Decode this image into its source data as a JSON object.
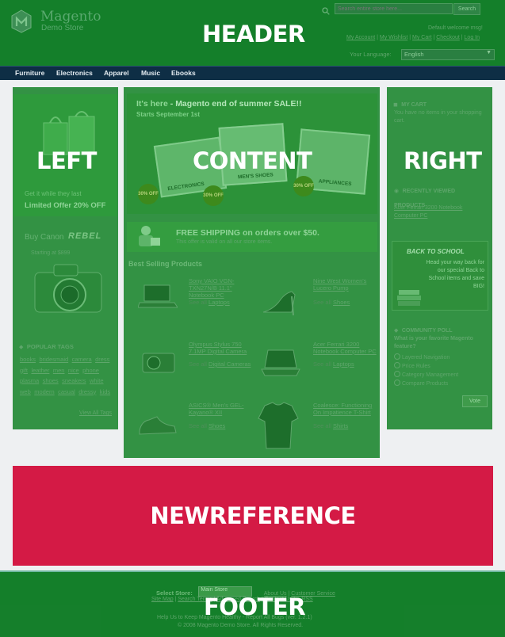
{
  "header": {
    "logo_main": "Magento",
    "logo_sub": "Demo Store",
    "overlay_label": "HEADER",
    "search_placeholder": "Search entire store here...",
    "search_button": "Search",
    "welcome": "Default welcome msg!",
    "links": [
      "My Account",
      "My Wishlist",
      "My Cart",
      "Checkout",
      "Log In"
    ],
    "language_label": "Your Language:",
    "language_value": "English"
  },
  "nav": {
    "items": [
      "Furniture",
      "Electronics",
      "Apparel",
      "Music",
      "Ebooks"
    ]
  },
  "left": {
    "overlay_label": "LEFT",
    "promo_line1": "Get it while they last",
    "promo_line2": "Limited Offer 20% OFF",
    "canon_buy": "Buy Canon",
    "canon_model": "REBEL",
    "canon_price": "Starting at $899",
    "tags_title": "POPULAR TAGS",
    "tags": [
      "books",
      "bridesmaid",
      "camera",
      "dress",
      "gift",
      "leather",
      "men",
      "nice",
      "phone",
      "plasma",
      "shoes",
      "sneakers",
      "white",
      "web",
      "modern",
      "casual",
      "dressy",
      "kids"
    ],
    "view_all": "View All Tags"
  },
  "content": {
    "overlay_label": "CONTENT",
    "banner_title_prefix": "It's here",
    "banner_title_suffix": " - Magento end of summer SALE!!",
    "banner_subtitle": "Starts September 1st",
    "card_labels": [
      "ELECTRONICS",
      "MEN'S SHOES",
      "APPLIANCES"
    ],
    "discount_badge": "30% OFF",
    "shipping_title": "FREE SHIPPING on orders over $50.",
    "shipping_sub": "This offer is valid on all our store items.",
    "best_selling": "Best Selling Products",
    "products": [
      {
        "name": "Sony VAIO VGN-TXN27N/B 11.1\" Notebook PC",
        "see_prefix": "See all ",
        "category": "Laptops"
      },
      {
        "name": "Nine West Women's Lucero Pump",
        "see_prefix": "See all ",
        "category": "Shoes"
      },
      {
        "name": "Olympus Stylus 750 7.1MP Digital Camera",
        "see_prefix": "See all ",
        "category": "Digital Cameras"
      },
      {
        "name": "Acer Ferrari 3200 Notebook Computer PC",
        "see_prefix": "See all ",
        "category": "Laptops"
      },
      {
        "name": "ASICS® Men's GEL-Kayano® XII",
        "see_prefix": "See all ",
        "category": "Shoes"
      },
      {
        "name": "Coalesce: Functioning On Impatience T-Shirt",
        "see_prefix": "See all ",
        "category": "Shirts"
      }
    ]
  },
  "right": {
    "overlay_label": "RIGHT",
    "cart_title": "MY CART",
    "cart_text": "You have no items in your shopping cart.",
    "recently_title": "RECENTLY VIEWED PRODUCTS",
    "recently_item": "Acer Ferrari 3200 Notebook Computer PC",
    "school_title": "BACK TO SCHOOL",
    "school_text": "Head your way back for our special Back to School items and save BIG!",
    "poll_title": "COMMUNITY POLL",
    "poll_question": "What is your favorite Magento feature?",
    "poll_options": [
      "Layered Navigation",
      "Price Rules",
      "Category Management",
      "Compare Products"
    ],
    "vote_button": "Vote"
  },
  "newreference": {
    "label": "NEWREFERENCE"
  },
  "footer": {
    "overlay_label": "FOOTER",
    "select_store_label": "Select Store:",
    "select_store_value": "Main Store",
    "links_row1": [
      "About Us",
      "Customer Service"
    ],
    "links_row2": [
      "Site Map",
      "Search Terms",
      "Advanced Search",
      "Contact Us",
      "RSS"
    ],
    "help_text": "Help Us to Keep Magento Healthy - Report All Bugs (ver. 1.2.1)",
    "copyright": "© 2008 Magento Demo Store. All Rights Reserved."
  },
  "colors": {
    "overlay_green": "#148228",
    "newreference_red": "#d41a45",
    "nav_bar": "#0e2e45"
  }
}
